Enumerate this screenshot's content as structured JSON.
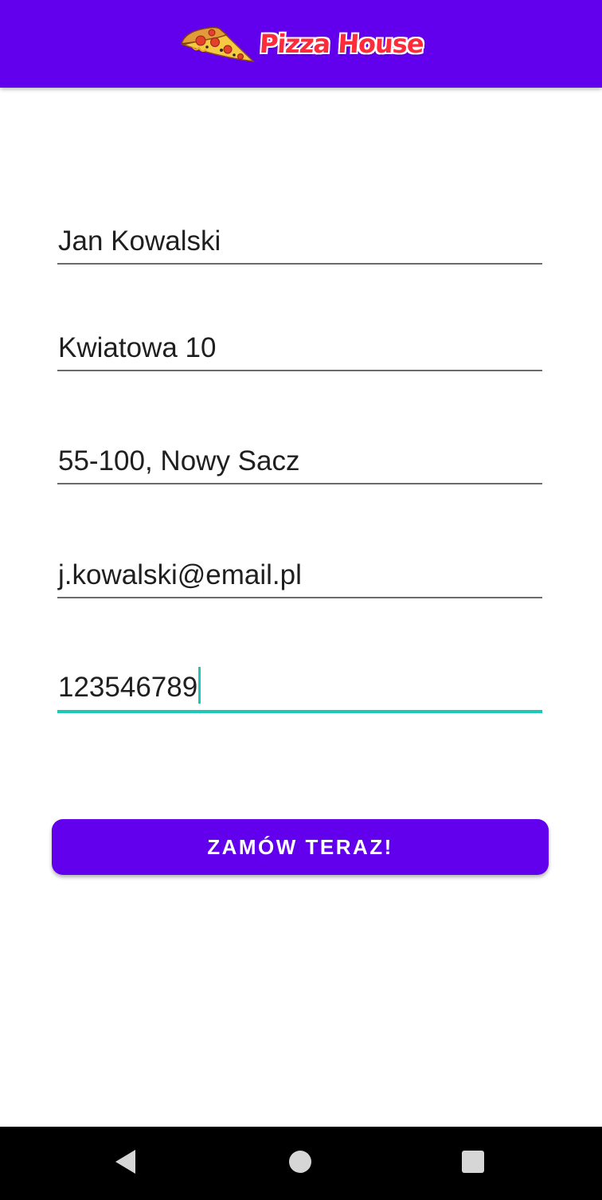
{
  "header": {
    "logo_text": "Pizza House",
    "logo_icon": "pizza-slice-icon",
    "background_color": "#6200ee"
  },
  "form": {
    "name": "Jan Kowalski",
    "street": "Kwiatowa 10",
    "city": "55-100, Nowy Sacz",
    "email": "j.kowalski@email.pl",
    "phone": "123546789",
    "focused_field": "phone",
    "focus_color": "#1ec8b8"
  },
  "order_button": {
    "label": "ZAMÓW TERAZ!",
    "color": "#6200ee"
  },
  "nav_bar": {
    "back_icon": "back-triangle-icon",
    "home_icon": "home-circle-icon",
    "recents_icon": "recents-square-icon"
  }
}
